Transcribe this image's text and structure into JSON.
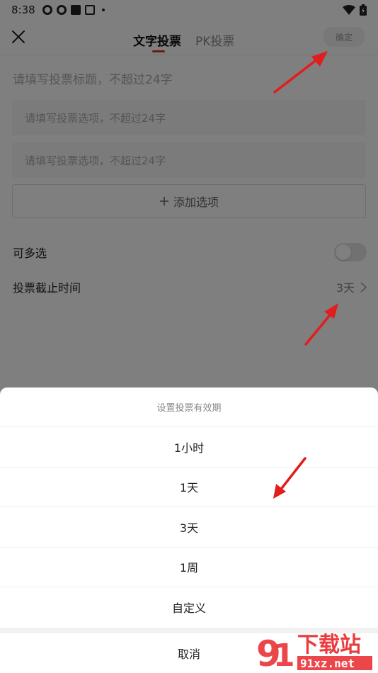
{
  "status_bar": {
    "time": "8:38"
  },
  "nav": {
    "tabs": [
      {
        "label": "文字投票",
        "active": true
      },
      {
        "label": "PK投票",
        "active": false
      }
    ],
    "confirm_label": "确定"
  },
  "form": {
    "title_placeholder": "请填写投票标题，不超过24字",
    "options": [
      {
        "placeholder": "请填写投票选项，不超过24字"
      },
      {
        "placeholder": "请填写投票选项，不超过24字"
      }
    ],
    "add_option_label": "添加选项",
    "multi_select_label": "可多选",
    "multi_select_enabled": false,
    "deadline_label": "投票截止时间",
    "deadline_value": "3天"
  },
  "sheet": {
    "title": "设置投票有效期",
    "items": [
      {
        "label": "1小时"
      },
      {
        "label": "1天"
      },
      {
        "label": "3天"
      },
      {
        "label": "1周"
      },
      {
        "label": "自定义"
      }
    ],
    "cancel_label": "取消"
  },
  "colors": {
    "accent": "#d9342b",
    "overlay": "#000000",
    "arrow": "#e11d1d"
  },
  "watermark": {
    "logo_text": "下载站",
    "domain": "91xz.net"
  }
}
